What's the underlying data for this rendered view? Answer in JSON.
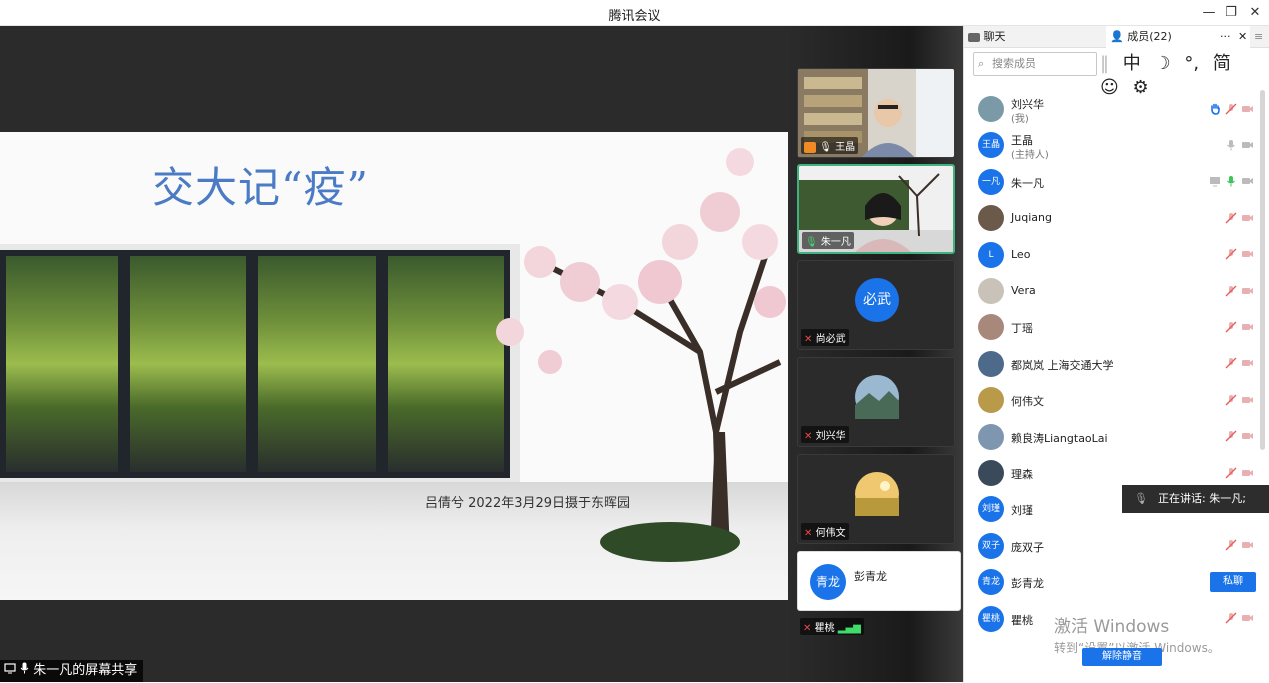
{
  "window": {
    "title": "腾讯会议",
    "minimize": "—",
    "restore": "❐",
    "close": "✕"
  },
  "slide": {
    "title": "交大记“疫”",
    "caption": "吕倩兮  2022年3月29日摄于东晖园"
  },
  "share_label": "朱一凡的屏幕共享",
  "videos": [
    {
      "name": "王晶",
      "kind": "camera"
    },
    {
      "name": "朱一凡",
      "kind": "camera"
    },
    {
      "name": "尚必武",
      "kind": "avatar",
      "avatar_text": "必武"
    },
    {
      "name": "刘兴华",
      "kind": "photo"
    },
    {
      "name": "何伟文",
      "kind": "photo"
    },
    {
      "name": "彭青龙",
      "kind": "light",
      "avatar_text": "青龙"
    },
    {
      "name": "瞿桃",
      "kind": "label"
    }
  ],
  "panel": {
    "tab_chat": "聊天",
    "tab_members": "成员(22)",
    "more": "···",
    "close": "✕",
    "menu": "≡",
    "search_placeholder": "搜索成员",
    "ime": [
      "中",
      "☽",
      "°,",
      "简",
      "☺",
      "⚙"
    ]
  },
  "members": [
    {
      "name": "刘兴华",
      "sub": "(我)",
      "avatar": "",
      "avatar_color": "#7a9aa8"
    },
    {
      "name": "王晶",
      "sub": "(主持人)",
      "avatar": "王晶",
      "avatar_color": "#1a73e8"
    },
    {
      "name": "朱一凡",
      "sub": "",
      "avatar": "一凡",
      "avatar_color": "#1a73e8"
    },
    {
      "name": "Juqiang",
      "sub": "",
      "avatar": "",
      "avatar_color": "#6b5a4a"
    },
    {
      "name": "Leo",
      "sub": "",
      "avatar": "L",
      "avatar_color": "#1a73e8"
    },
    {
      "name": "Vera",
      "sub": "",
      "avatar": "",
      "avatar_color": "#c9c2b8"
    },
    {
      "name": "丁瑶",
      "sub": "",
      "avatar": "",
      "avatar_color": "#a8887a"
    },
    {
      "name": "都岚岚 上海交通大学",
      "sub": "",
      "avatar": "",
      "avatar_color": "#4d6a8a"
    },
    {
      "name": "何伟文",
      "sub": "",
      "avatar": "",
      "avatar_color": "#b89a4a"
    },
    {
      "name": "赖良涛LiangtaoLai",
      "sub": "",
      "avatar": "",
      "avatar_color": "#7f96b0"
    },
    {
      "name": "理森",
      "sub": "",
      "avatar": "",
      "avatar_color": "#3b4a5a"
    },
    {
      "name": "刘瑾",
      "sub": "",
      "avatar": "刘瑾",
      "avatar_color": "#1a73e8"
    },
    {
      "name": "庞双子",
      "sub": "",
      "avatar": "双子",
      "avatar_color": "#1a73e8"
    },
    {
      "name": "彭青龙",
      "sub": "",
      "avatar": "青龙",
      "avatar_color": "#1a73e8"
    },
    {
      "name": "瞿桃",
      "sub": "",
      "avatar": "瞿桃",
      "avatar_color": "#1a73e8"
    }
  ],
  "speaking": "正在讲话: 朱一凡;",
  "private_chat": "私聊",
  "activation": {
    "line1": "激活 Windows",
    "line2": "转到“设置”以激活 Windows。"
  },
  "unmute": "解除静音"
}
